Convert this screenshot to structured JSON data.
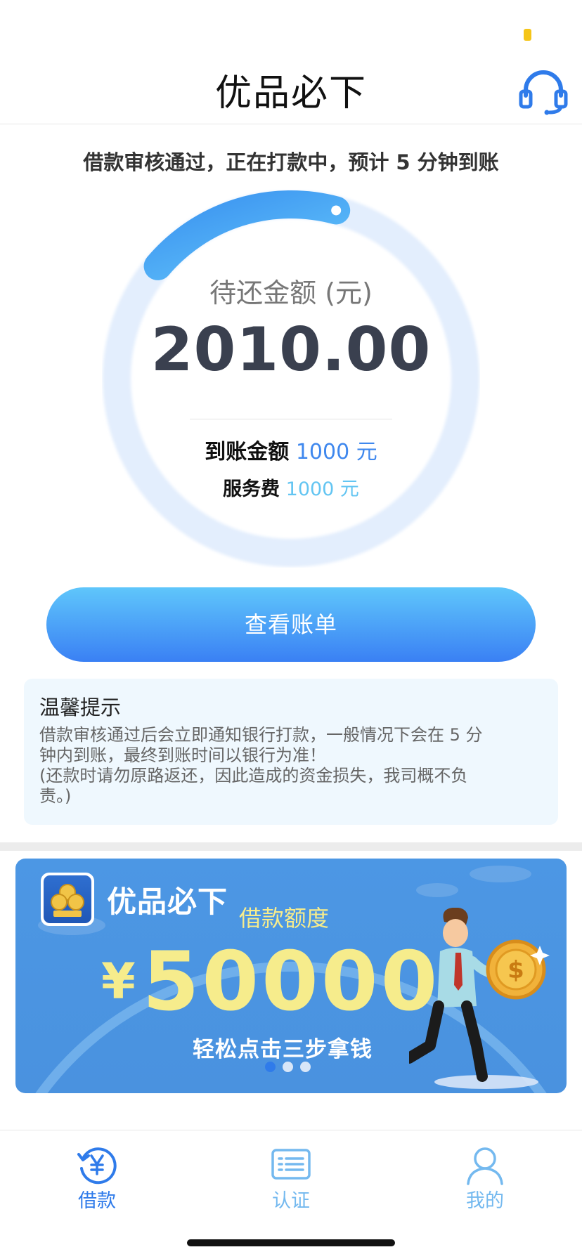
{
  "header": {
    "title": "优品必下",
    "support_icon": "headset-icon"
  },
  "status": {
    "message": "借款审核通过，正在打款中，预计 5 分钟到账"
  },
  "summary": {
    "amount_label": "待还金额 (元)",
    "amount_value": "2010.00",
    "progress_fraction": 0.18,
    "received_label": "到账金额",
    "received_value": "1000 元",
    "fee_label": "服务费",
    "fee_value": "1000 元"
  },
  "actions": {
    "view_bill_label": "查看账单"
  },
  "tips": {
    "title": "温馨提示",
    "lines": [
      "借款审核通过后会立即通知银行打款，一般情况下会在 5 分",
      "钟内到账，最终到账时间以银行为准！",
      "(还款时请勿原路返还，因此造成的资金损失，我司概不负",
      "责。)"
    ]
  },
  "banner": {
    "brand": "优品必下",
    "quota_label": "借款额度",
    "currency_symbol": "¥",
    "amount": "50000",
    "slogan": "轻松点击三步拿钱",
    "slide_count": 3,
    "active_slide": 0
  },
  "tabbar": {
    "items": [
      {
        "label": "借款",
        "icon": "yen-refresh-icon",
        "active": true
      },
      {
        "label": "认证",
        "icon": "id-card-icon",
        "active": false
      },
      {
        "label": "我的",
        "icon": "user-icon",
        "active": false
      }
    ]
  },
  "colors": {
    "accent": "#2f7bea",
    "accent_light": "#63c5f2",
    "banner_bg": "#4c97e4",
    "banner_highlight": "#f6ec8c",
    "tip_bg": "#eff8fe"
  }
}
